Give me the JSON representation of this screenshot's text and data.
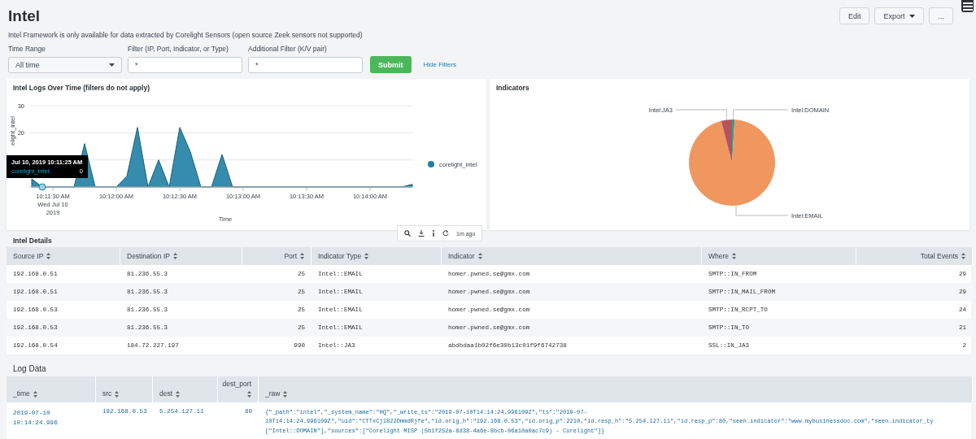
{
  "page": {
    "title": "Intel",
    "subtitle": "Intel Framework is only available for data extracted by Corelight Sensors (open source Zeek sensors not supported)",
    "actions": [
      {
        "label": "Edit",
        "kind": "plain"
      },
      {
        "label": "Export",
        "kind": "dropdown"
      },
      {
        "label": "...",
        "kind": "plain"
      }
    ]
  },
  "filters": {
    "time_range": {
      "label": "Time Range",
      "value": "All time"
    },
    "filter": {
      "label": "Filter (IP, Port, Indicator, or Type)",
      "value": "*"
    },
    "additional": {
      "label": "Additional Filter (K/V pair)",
      "value": "*"
    },
    "submit": "Submit",
    "hide": "Hide Filters"
  },
  "logs_panel": {
    "title": "Intel Logs Over Time (filters do not apply)",
    "chart_data": {
      "type": "area",
      "xlabel": "Time",
      "ylabel": "elight_intel",
      "categories": [
        null,
        null,
        "10:11:30 AM\nWed Jul 10\n2019",
        null,
        null,
        null,
        null,
        null,
        "10:12:00 AM",
        null,
        null,
        null,
        null,
        null,
        "10:12:30 AM",
        null,
        null,
        null,
        null,
        null,
        "10:13:00 AM",
        null,
        null,
        null,
        null,
        null,
        "10:13:30 AM",
        null,
        null,
        null,
        null,
        null,
        "10:14:00 AM",
        null,
        null,
        null,
        null
      ],
      "series": [
        {
          "name": "corelight_intel",
          "color": "#1f7fa3",
          "values": [
            3,
            0,
            0,
            0,
            0,
            16,
            0,
            0,
            0,
            4,
            22,
            0,
            10,
            0,
            22,
            13,
            0,
            0,
            12,
            0,
            0,
            0,
            0,
            0,
            0,
            0,
            0,
            0,
            0,
            0,
            0,
            0,
            0,
            0,
            0,
            0,
            1
          ]
        }
      ],
      "ylim": [
        0,
        30
      ],
      "yticks": [
        20,
        30
      ]
    },
    "tooltip": {
      "title": "Jul 10, 2019 10:11:25 AM",
      "series": "corelight_intel:",
      "value": "0"
    },
    "toolbar": {
      "age": "1m ago"
    }
  },
  "indicators_panel": {
    "title": "Indicators",
    "chart_data": {
      "type": "pie",
      "categories": [
        "Intel:DOMAIN",
        "Intel:EMAIL",
        "Intel:JA3"
      ],
      "series": [
        {
          "values": [
            1,
            95,
            4
          ]
        }
      ],
      "colors": [
        "#3d9c87",
        "#f0975f",
        "#b5525c"
      ]
    }
  },
  "details": {
    "title": "Intel Details",
    "columns": [
      {
        "label": "Source IP",
        "numeric": false
      },
      {
        "label": "Destination IP",
        "numeric": false
      },
      {
        "label": "Port",
        "numeric": true
      },
      {
        "label": "Indicator Type",
        "numeric": false
      },
      {
        "label": "Indicator",
        "numeric": false
      },
      {
        "label": "Where",
        "numeric": false
      },
      {
        "label": "Total Events",
        "numeric": true
      }
    ],
    "rows": [
      [
        "192.168.0.51",
        "81.236.55.3",
        "25",
        "Intel::EMAIL",
        "homer.pwned.se@gmx.com",
        "SMTP::IN_FROM",
        "29"
      ],
      [
        "192.168.0.51",
        "81.236.55.3",
        "25",
        "Intel::EMAIL",
        "homer.pwned.se@gmx.com",
        "SMTP::IN_MAIL_FROM",
        "29"
      ],
      [
        "192.168.0.53",
        "81.236.55.3",
        "25",
        "Intel::EMAIL",
        "homer.pwned.se@gmx.com",
        "SMTP::IN_RCPT_TO",
        "24"
      ],
      [
        "192.168.0.53",
        "81.236.55.3",
        "25",
        "Intel::EMAIL",
        "homer.pwned.se@gmx.com",
        "SMTP::IN_TO",
        "21"
      ],
      [
        "192.168.0.54",
        "184.72.227.197",
        "990",
        "Intel::JA3",
        "abdbdaa1b02f6e30b13c01f9f6742738",
        "SSL::IN_JA3",
        "2"
      ]
    ]
  },
  "log_data": {
    "title": "Log Data",
    "columns": [
      {
        "label": "_time",
        "numeric": false
      },
      {
        "label": "src",
        "numeric": false
      },
      {
        "label": "dest",
        "numeric": false
      },
      {
        "label": "dest_port",
        "numeric": true
      },
      {
        "label": "_raw",
        "numeric": false
      }
    ],
    "rows": [
      {
        "cells": [
          "2019-07-10 10:14:24.996",
          "192.168.0.53",
          "5.254.127.11",
          "80"
        ],
        "raw": [
          "{\"_path\":\"intel\",\"_system_name\":\"HQ\",\"_write_ts\":\"2019-07-10T14:14:24.996109Z\",\"ts\":\"2019-07-",
          "10T14:14:24.996109Z\",\"uid\":\"CTTxCj1822DmmdRjfe\",\"id.orig_h\":\"192.168.0.53\",\"id.orig_p\":2210,\"id.resp_h\":\"5.254.127.11\",\"id.resp_p\":80,\"seen.indicator\":\"www.mybusinessdoc.com\",\"seen.indicator_ty",
          "[\"Intel::DOMAIN\"],\"sources\":[\"Corelight MISP (5b1f252a-8d38-4a6e-8bcb-06a10a0ac7c9) - Corelight\"]}"
        ]
      }
    ]
  }
}
